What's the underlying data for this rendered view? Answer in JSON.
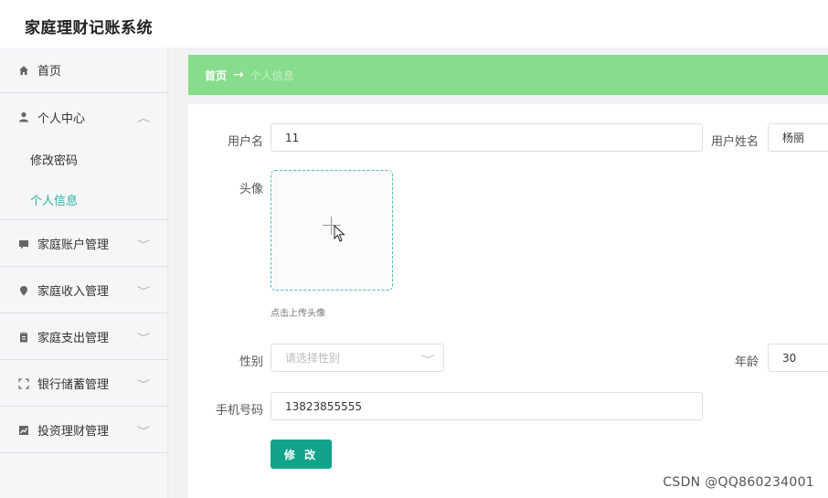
{
  "app": {
    "title": "家庭理财记账系统"
  },
  "sidebar": {
    "items": [
      {
        "label": "首页",
        "icon": "home-icon"
      },
      {
        "label": "个人中心",
        "icon": "user-icon",
        "expanded": true,
        "children": [
          {
            "label": "修改密码",
            "active": false
          },
          {
            "label": "个人信息",
            "active": true
          }
        ]
      },
      {
        "label": "家庭账户管理",
        "icon": "message-icon"
      },
      {
        "label": "家庭收入管理",
        "icon": "location-icon"
      },
      {
        "label": "家庭支出管理",
        "icon": "document-icon"
      },
      {
        "label": "银行储蓄管理",
        "icon": "fullscreen-icon"
      },
      {
        "label": "投资理财管理",
        "icon": "chart-icon"
      }
    ]
  },
  "breadcrumb": {
    "home": "首页",
    "separator": "→",
    "current": "个人信息"
  },
  "form": {
    "username_label": "用户名",
    "username_value": "11",
    "realname_label": "用户姓名",
    "realname_value": "杨丽",
    "avatar_label": "头像",
    "avatar_hint": "点击上传头像",
    "gender_label": "性别",
    "gender_placeholder": "请选择性别",
    "age_label": "年龄",
    "age_value": "30",
    "phone_label": "手机号码",
    "phone_value": "13823855555",
    "submit_label": "修 改"
  },
  "watermark": "CSDN @QQ860234001",
  "colors": {
    "accent": "#2bb5a0",
    "breadcrumb_bg": "#88dd8c",
    "button": "#12a48a"
  }
}
